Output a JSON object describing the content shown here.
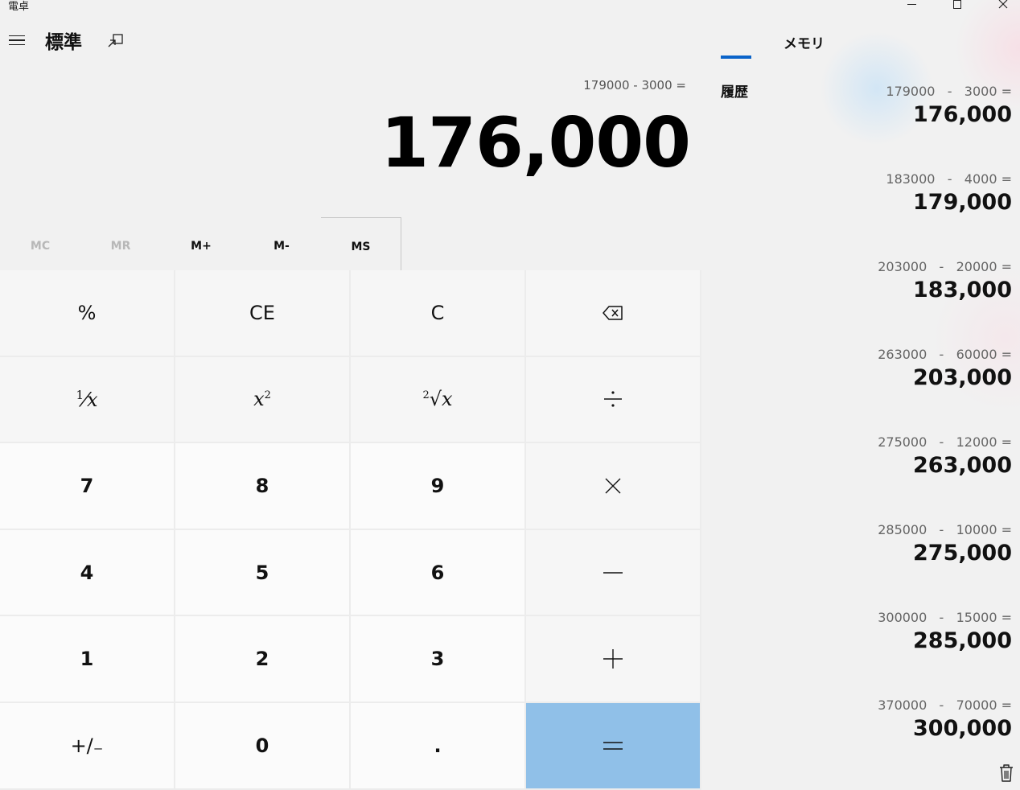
{
  "window": {
    "title": "電卓",
    "icons": {
      "minimize": "minimize-icon",
      "maximize": "maximize-icon",
      "close": "close-icon"
    }
  },
  "header": {
    "mode_title": "標準",
    "menu_icon": "hamburger-icon",
    "keep_on_top_icon": "keep-on-top-icon"
  },
  "tabs": [
    {
      "label": "履歴",
      "selected": true
    },
    {
      "label": "メモリ",
      "selected": false
    }
  ],
  "display": {
    "expression": "179000 - 3000 =",
    "result": "176,000"
  },
  "memory_buttons": [
    {
      "label": "MC",
      "enabled": false
    },
    {
      "label": "MR",
      "enabled": false
    },
    {
      "label": "M+",
      "enabled": true
    },
    {
      "label": "M-",
      "enabled": true
    },
    {
      "label": "MS",
      "enabled": true
    }
  ],
  "keys": {
    "percent": "%",
    "clear_entry": "CE",
    "clear": "C",
    "backspace_icon": "backspace-icon",
    "reciprocal_num": "1",
    "reciprocal_den": "x",
    "square_base": "x",
    "square_exp": "2",
    "sqrt_index": "2",
    "sqrt_base": "x",
    "divide_icon": "divide-icon",
    "seven": "7",
    "eight": "8",
    "nine": "9",
    "multiply_icon": "multiply-icon",
    "four": "4",
    "five": "5",
    "six": "6",
    "minus_icon": "minus-icon",
    "one": "1",
    "two": "2",
    "three": "3",
    "plus_icon": "plus-icon",
    "negate": "+/₋",
    "zero": "0",
    "decimal": ".",
    "equals_icon": "equals-icon"
  },
  "history": [
    {
      "a": "179000",
      "op": "-",
      "b": "3000",
      "eq": "=",
      "result": "176,000"
    },
    {
      "a": "183000",
      "op": "-",
      "b": "4000",
      "eq": "=",
      "result": "179,000"
    },
    {
      "a": "203000",
      "op": "-",
      "b": "20000",
      "eq": "=",
      "result": "183,000"
    },
    {
      "a": "263000",
      "op": "-",
      "b": "60000",
      "eq": "=",
      "result": "203,000"
    },
    {
      "a": "275000",
      "op": "-",
      "b": "12000",
      "eq": "=",
      "result": "263,000"
    },
    {
      "a": "285000",
      "op": "-",
      "b": "10000",
      "eq": "=",
      "result": "275,000"
    },
    {
      "a": "300000",
      "op": "-",
      "b": "15000",
      "eq": "=",
      "result": "285,000"
    },
    {
      "a": "370000",
      "op": "-",
      "b": "70000",
      "eq": "=",
      "result": "300,000"
    }
  ],
  "history_delete_icon": "trash-icon",
  "colors": {
    "accent": "#0a63c9",
    "equals_key": "#90c0e8",
    "background": "#f1f1f1"
  }
}
